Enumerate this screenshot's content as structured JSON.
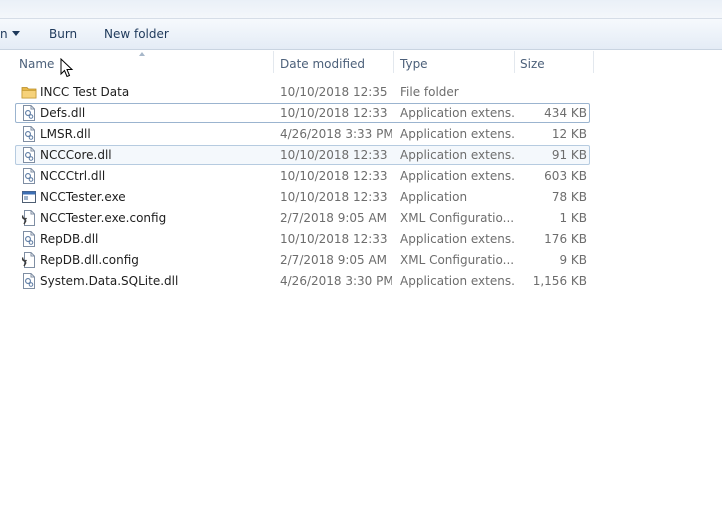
{
  "toolbar": {
    "first_item_partial": "n",
    "burn": "Burn",
    "new_folder": "New folder"
  },
  "columns": {
    "name": "Name",
    "date": "Date modified",
    "type": "Type",
    "size": "Size"
  },
  "files": [
    {
      "name": "INCC Test Data",
      "date": "10/10/2018 12:35 ...",
      "type": "File folder",
      "size": "",
      "icon": "folder-icon"
    },
    {
      "name": "Defs.dll",
      "date": "10/10/2018 12:33 ...",
      "type": "Application extens...",
      "size": "434 KB",
      "icon": "dll-file-icon"
    },
    {
      "name": "LMSR.dll",
      "date": "4/26/2018 3:33 PM",
      "type": "Application extens...",
      "size": "12 KB",
      "icon": "dll-file-icon"
    },
    {
      "name": "NCCCore.dll",
      "date": "10/10/2018 12:33 ...",
      "type": "Application extens...",
      "size": "91 KB",
      "icon": "dll-file-icon"
    },
    {
      "name": "NCCCtrl.dll",
      "date": "10/10/2018 12:33 ...",
      "type": "Application extens...",
      "size": "603 KB",
      "icon": "dll-file-icon"
    },
    {
      "name": "NCCTester.exe",
      "date": "10/10/2018 12:33 ...",
      "type": "Application",
      "size": "78 KB",
      "icon": "exe-file-icon"
    },
    {
      "name": "NCCTester.exe.config",
      "date": "2/7/2018 9:05 AM",
      "type": "XML Configuratio...",
      "size": "1 KB",
      "icon": "config-file-icon"
    },
    {
      "name": "RepDB.dll",
      "date": "10/10/2018 12:33 ...",
      "type": "Application extens...",
      "size": "176 KB",
      "icon": "dll-file-icon"
    },
    {
      "name": "RepDB.dll.config",
      "date": "2/7/2018 9:05 AM",
      "type": "XML Configuratio...",
      "size": "9 KB",
      "icon": "config-file-icon"
    },
    {
      "name": "System.Data.SQLite.dll",
      "date": "4/26/2018 3:30 PM",
      "type": "Application extens...",
      "size": "1,156 KB",
      "icon": "dll-file-icon"
    }
  ]
}
